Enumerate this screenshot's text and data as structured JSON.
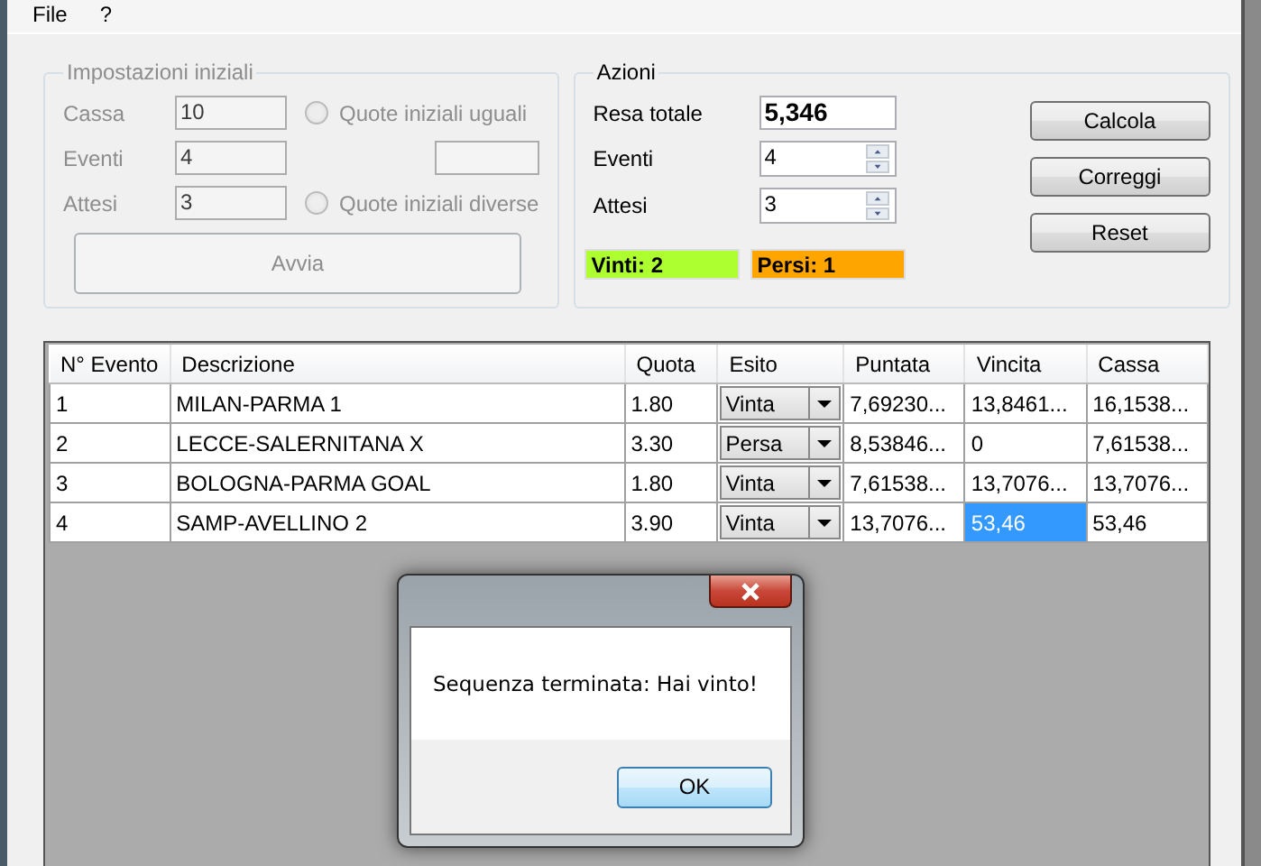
{
  "menu": [
    "File",
    "?"
  ],
  "settings": {
    "title": "Impostazioni iniziali",
    "disabled": true,
    "fields": [
      {
        "label": "Cassa",
        "value": "10"
      },
      {
        "label": "Eventi",
        "value": "4"
      },
      {
        "label": "Attesi",
        "value": "3"
      }
    ],
    "radios": [
      {
        "label": "Quote iniziali uguali",
        "selected": false
      },
      {
        "label": "Quote iniziali diverse",
        "selected": false
      }
    ],
    "start_button": "Avvia"
  },
  "actions": {
    "title": "Azioni",
    "total": {
      "label": "Resa totale",
      "value": "5,346"
    },
    "spinners": [
      {
        "label": "Eventi",
        "value": "4"
      },
      {
        "label": "Attesi",
        "value": "3"
      }
    ],
    "counters": [
      {
        "text": "Vinti: 2",
        "color": "#adff2f"
      },
      {
        "text": "Persi: 1",
        "color": "#ffa500"
      }
    ],
    "buttons": [
      "Calcola",
      "Correggi",
      "Reset"
    ]
  },
  "table": {
    "columns": [
      "N° Evento",
      "Descrizione",
      "Quota",
      "Esito",
      "Puntata",
      "Vincita",
      "Cassa"
    ],
    "rows": [
      [
        {
          "kind": "text",
          "text": "1",
          "selected": false
        },
        {
          "kind": "text",
          "text": "MILAN-PARMA 1",
          "selected": false
        },
        {
          "kind": "text",
          "text": "1.80",
          "selected": false
        },
        {
          "kind": "combo",
          "text": "Vinta",
          "selected": false
        },
        {
          "kind": "text",
          "text": "7,69230...",
          "selected": false
        },
        {
          "kind": "text",
          "text": "13,8461...",
          "selected": false
        },
        {
          "kind": "text",
          "text": "16,1538...",
          "selected": false
        }
      ],
      [
        {
          "kind": "text",
          "text": "2",
          "selected": false
        },
        {
          "kind": "text",
          "text": "LECCE-SALERNITANA X",
          "selected": false
        },
        {
          "kind": "text",
          "text": "3.30",
          "selected": false
        },
        {
          "kind": "combo",
          "text": "Persa",
          "selected": false
        },
        {
          "kind": "text",
          "text": "8,53846...",
          "selected": false
        },
        {
          "kind": "text",
          "text": "0",
          "selected": false
        },
        {
          "kind": "text",
          "text": "7,61538...",
          "selected": false
        }
      ],
      [
        {
          "kind": "text",
          "text": "3",
          "selected": false
        },
        {
          "kind": "text",
          "text": "BOLOGNA-PARMA GOAL",
          "selected": false
        },
        {
          "kind": "text",
          "text": "1.80",
          "selected": false
        },
        {
          "kind": "combo",
          "text": "Vinta",
          "selected": false
        },
        {
          "kind": "text",
          "text": "7,61538...",
          "selected": false
        },
        {
          "kind": "text",
          "text": "13,7076...",
          "selected": false
        },
        {
          "kind": "text",
          "text": "13,7076...",
          "selected": false
        }
      ],
      [
        {
          "kind": "text",
          "text": "4",
          "selected": false
        },
        {
          "kind": "text",
          "text": "SAMP-AVELLINO 2",
          "selected": false
        },
        {
          "kind": "text",
          "text": "3.90",
          "selected": false
        },
        {
          "kind": "combo",
          "text": "Vinta",
          "selected": false
        },
        {
          "kind": "text",
          "text": "13,7076...",
          "selected": false
        },
        {
          "kind": "text",
          "text": "53,46",
          "selected": true
        },
        {
          "kind": "text",
          "text": "53,46",
          "selected": false
        }
      ]
    ]
  },
  "dialog": {
    "message": "Sequenza terminata: Hai vinto!",
    "button": "OK"
  }
}
